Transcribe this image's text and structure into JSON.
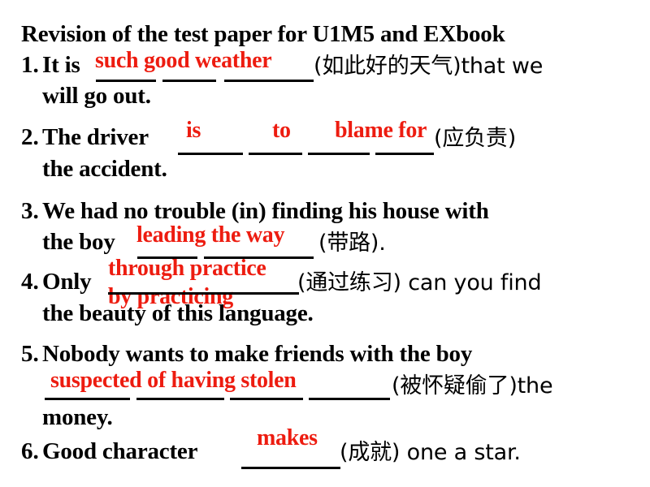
{
  "slide": {
    "title": "Revision of the test paper for U1M5 and EXbook",
    "accent_color": "#ED1C10",
    "text_color": "#000000",
    "background_color": "#FFFFFF"
  },
  "items": [
    {
      "number": "1.",
      "line1_pre": "It is",
      "line1_post": "(如此好的天气)that we",
      "line2": "will go out.",
      "answer": "such good weather",
      "blanks": 3
    },
    {
      "number": "2.",
      "line1_pre": "The driver",
      "line1_post": "(应负责)",
      "line2": "the accident.",
      "answer_1": "is",
      "answer_2": "to",
      "answer_3": "blame for",
      "blanks": 4
    },
    {
      "number": "3.",
      "line1": "We had no trouble (in) finding his house with",
      "line2_pre": "the boy",
      "line2_post": "(带路).",
      "answer": "leading the way",
      "blanks": 2
    },
    {
      "number": "4.",
      "line1_pre": "Only",
      "line1_post": "(通过练习) can you find",
      "line2": "the beauty of this language.",
      "answer_1": "through practice",
      "answer_2": "by practicing",
      "blanks": 1
    },
    {
      "number": "5.",
      "line1": "Nobody wants to make friends with the boy",
      "line2_post": "(被怀疑偷了)the",
      "line3": "money.",
      "answer": "suspected of having stolen",
      "blanks": 4
    },
    {
      "number": "6.",
      "line1_pre": "Good character",
      "line1_post": "(成就) one a star.",
      "answer": "makes",
      "blanks": 1
    }
  ]
}
